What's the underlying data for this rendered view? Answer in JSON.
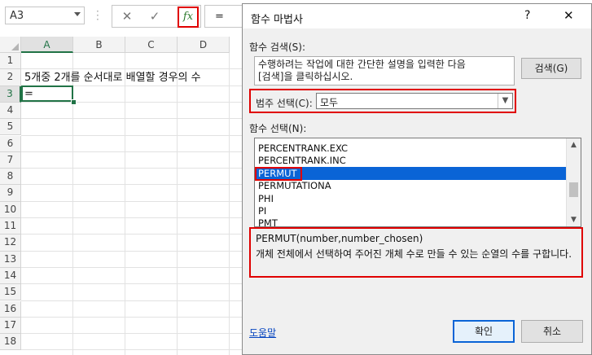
{
  "formula_bar": {
    "name_box": "A3",
    "cancel_icon": "close-icon",
    "enter_icon": "check-icon",
    "fx_label": "fx",
    "formula": "="
  },
  "sheet": {
    "columns": [
      "A",
      "B",
      "C",
      "D"
    ],
    "rows": [
      "1",
      "2",
      "3",
      "4",
      "5",
      "6",
      "7",
      "8",
      "9",
      "10",
      "11",
      "12",
      "13",
      "14",
      "15",
      "16",
      "17",
      "18"
    ],
    "active_column": "A",
    "active_row": "3",
    "cell_b2": "5개중 2개를 순서대로 배열할 경우의 수",
    "cell_a3": "="
  },
  "dialog": {
    "title": "함수 마법사",
    "help": "?",
    "close": "✕",
    "search_label": "함수 검색(S):",
    "search_placeholder": "수행하려는 작업에 대한 간단한 설명을 입력한 다음\n[검색]을 클릭하십시오.",
    "search_button": "검색(G)",
    "category_label": "범주 선택(C):",
    "category_value": "모두",
    "function_label": "함수 선택(N):",
    "functions": [
      "PERCENTRANK.EXC",
      "PERCENTRANK.INC",
      "PERMUT",
      "PERMUTATIONA",
      "PHI",
      "PI",
      "PMT"
    ],
    "selected_function": "PERMUT",
    "syntax": "PERMUT(number,number_chosen)",
    "description": "개체 전체에서 선택하여 주어진 개체 수로 만들 수 있는 순열의 수를 구합니다.",
    "help_link": "도움말",
    "ok": "확인",
    "cancel": "취소"
  }
}
